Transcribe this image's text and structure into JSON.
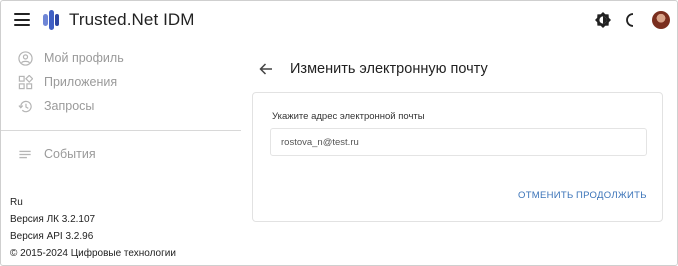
{
  "app": {
    "title": "Trusted.Net IDM",
    "icons": [
      "menu-icon",
      "logo-icon",
      "brightness-icon",
      "moon-icon",
      "avatar"
    ]
  },
  "sidebar": {
    "items": [
      {
        "label": "Мой профиль",
        "icon": "account-circle-icon"
      },
      {
        "label": "Приложения",
        "icon": "apps-icon"
      },
      {
        "label": "Запросы",
        "icon": "history-icon"
      },
      {
        "label": "События",
        "icon": "list-icon"
      }
    ],
    "footer": {
      "lang": "Ru",
      "lk_version": "Версия ЛК 3.2.107",
      "api_version": "Версия API 3.2.96",
      "copyright": "© 2015-2024 Цифровые технологии"
    }
  },
  "main": {
    "title": "Изменить электронную почту",
    "form": {
      "label": "Укажите адрес электронной почты",
      "email_value": "rostova_n@test.ru"
    },
    "actions": {
      "cancel": "ОТМЕНИТЬ",
      "continue": "ПРОДОЛЖИТЬ"
    }
  },
  "colors": {
    "accent": "#3a73b8",
    "logo": "#3f5fc4",
    "muted": "#9a9a9a"
  }
}
